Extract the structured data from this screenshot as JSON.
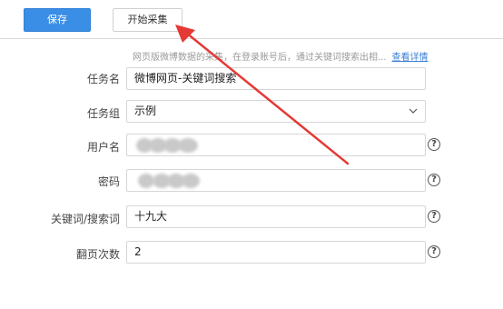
{
  "toolbar": {
    "save_label": "保存",
    "start_label": "开始采集"
  },
  "description": {
    "text": "网页版微博数据的采集，在登录账号后，通过关键词搜索出相...",
    "link": "查看详情"
  },
  "form": {
    "task_name": {
      "label": "任务名",
      "value": "微博网页-关键词搜索"
    },
    "task_group": {
      "label": "任务组",
      "value": "示例"
    },
    "username": {
      "label": "用户名",
      "value": ""
    },
    "password": {
      "label": "密码",
      "value": ""
    },
    "keyword": {
      "label": "关键词/搜索词",
      "value": "十九大"
    },
    "pages": {
      "label": "翻页次数",
      "value": "2"
    }
  },
  "help_glyph": "?",
  "annotation_color": "#e53935"
}
